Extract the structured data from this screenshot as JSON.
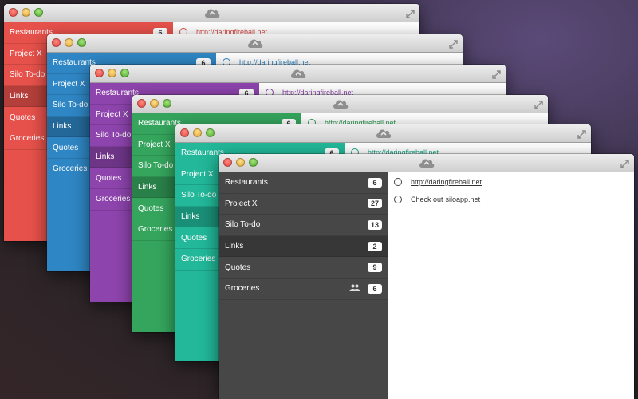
{
  "colors": {
    "red": "#e7514b",
    "blue": "#2f86c4",
    "purple": "#8e44ad",
    "green": "#35a55d",
    "teal": "#22b899",
    "dark": "#474747"
  },
  "icons": {
    "sync": "cloud-sync-icon",
    "fullscreen": "expand-icon",
    "shared": "group-icon",
    "task": "circle-checkbox-icon"
  },
  "windows": [
    {
      "id": "w1",
      "color": "#e7514b",
      "link_color": "#d84a44"
    },
    {
      "id": "w2",
      "color": "#2f86c4",
      "link_color": "#2f86c4"
    },
    {
      "id": "w3",
      "color": "#8e44ad",
      "link_color": "#8e44ad"
    },
    {
      "id": "w4",
      "color": "#35a55d",
      "link_color": "#2e9b54"
    },
    {
      "id": "w5",
      "color": "#22b899",
      "link_color": "#1aa788"
    }
  ],
  "lists": [
    {
      "label": "Restaurants",
      "count": "6"
    },
    {
      "label": "Project X",
      "count": "27"
    },
    {
      "label": "Silo To-do",
      "count": "13"
    },
    {
      "label": "Links",
      "count": "2"
    },
    {
      "label": "Quotes",
      "count": "9"
    },
    {
      "label": "Groceries",
      "count": "6",
      "shared": true
    }
  ],
  "selected_index": 3,
  "tasks": [
    {
      "text": "",
      "link": "http://daringfireball.net"
    },
    {
      "text": "Check out ",
      "link": "siloapp.net"
    }
  ]
}
